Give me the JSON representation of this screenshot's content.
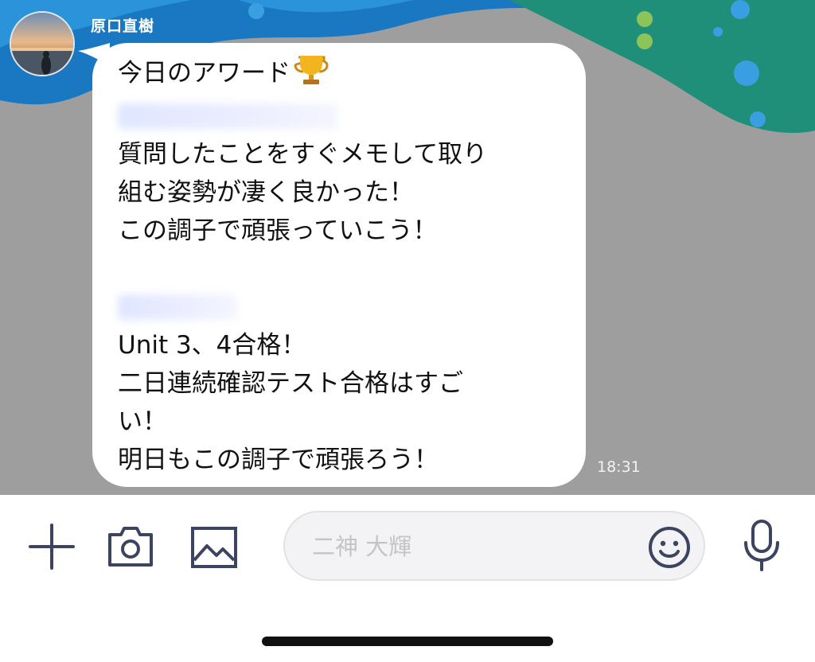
{
  "chat": {
    "sender_name": "原口直樹",
    "message": {
      "lines": {
        "l1": "今日のアワード",
        "l3": "質問したことをすぐメモして取り",
        "l4": "組む姿勢が凄く良かった！",
        "l5": "この調子で頑張っていこう！",
        "l8": "Unit 3、4合格！",
        "l9": "二日連続確認テスト合格はすご",
        "l10": "い！",
        "l11": "明日もこの調子で頑張ろう！"
      },
      "emoji_icon": "trophy-icon",
      "time": "18:31"
    }
  },
  "input_bar": {
    "placeholder": "二神 大輝",
    "icons": {
      "add": "plus-icon",
      "camera": "camera-icon",
      "gallery": "image-icon",
      "emoji": "smiley-icon",
      "voice": "microphone-icon"
    }
  },
  "colors": {
    "chat_background": "#9e9e9e",
    "wallpaper_blue": "#1a78c2",
    "wallpaper_teal": "#1f8f7a",
    "icon_color": "#3d4460",
    "bubble": "#ffffff"
  }
}
